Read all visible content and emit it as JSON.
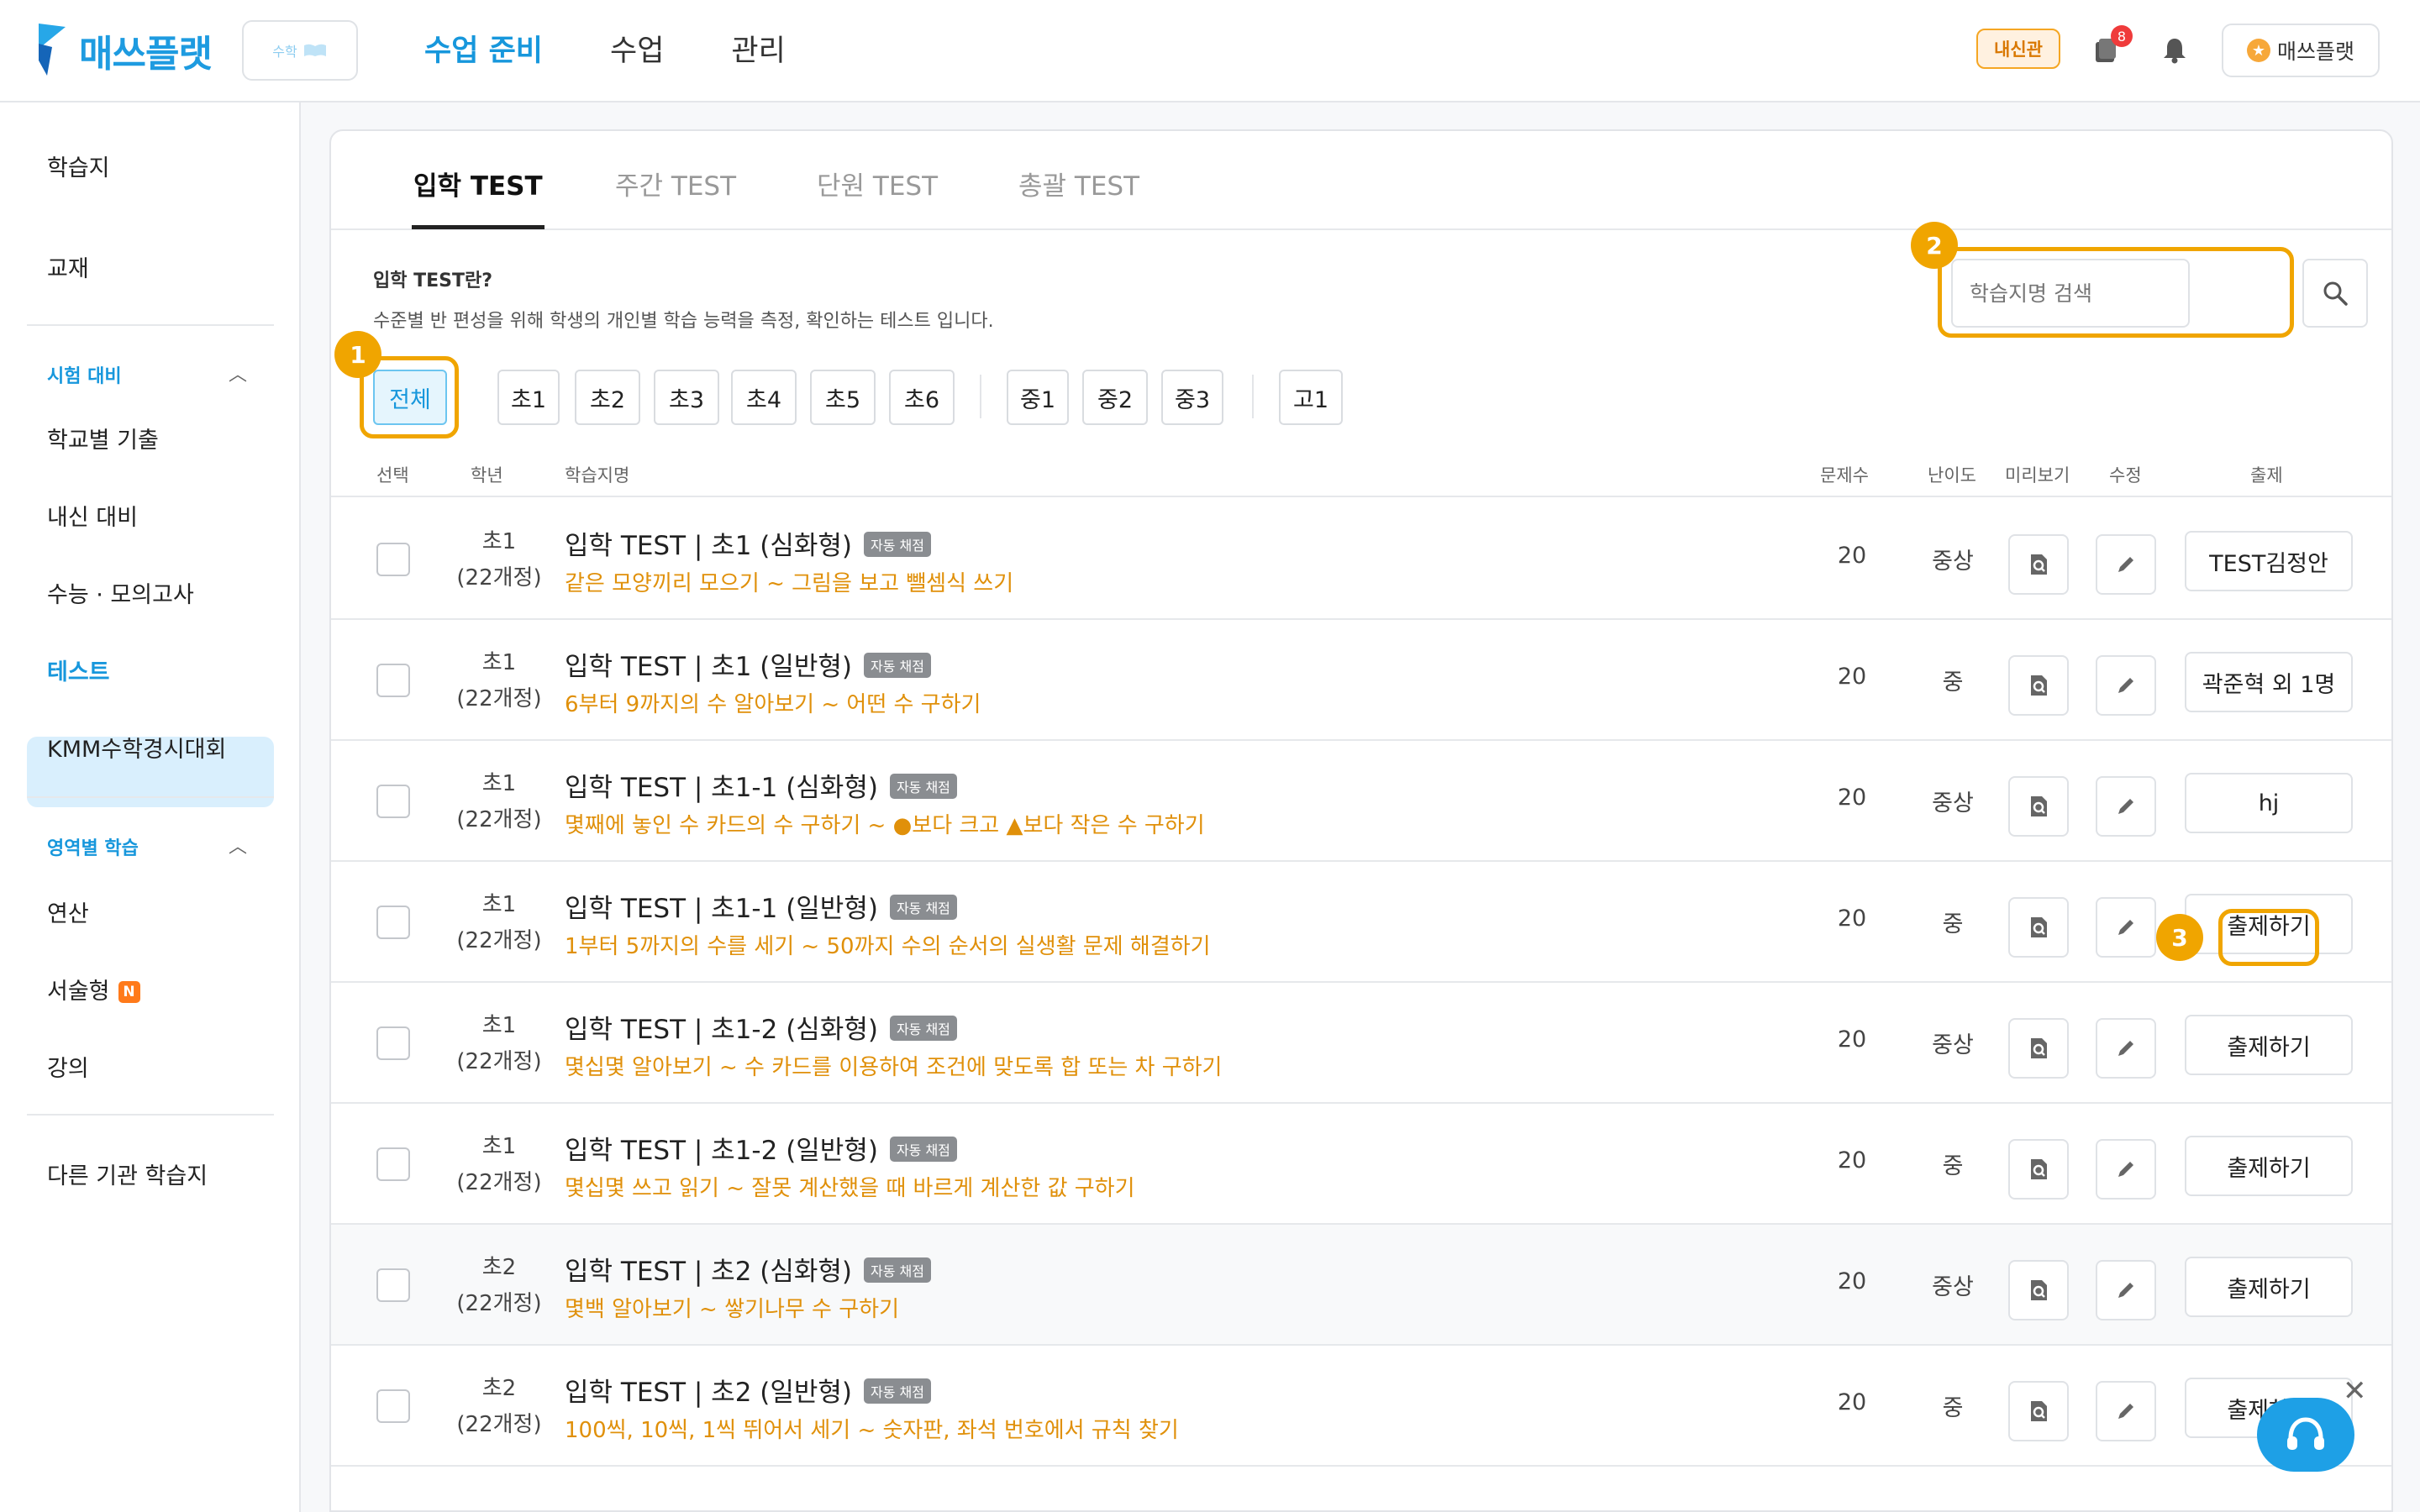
{
  "header": {
    "logo_text": "매쓰플랫",
    "subject_chip": "수학",
    "nav": [
      "수업 준비",
      "수업",
      "관리"
    ],
    "naesin_tag": "내신관",
    "notification_count": "8",
    "user_name": "매쓰플랫"
  },
  "sidebar": {
    "item_worksheets": "학습지",
    "item_textbook": "교재",
    "section_exam": "시험 대비",
    "item_school_past": "학교별 기출",
    "item_naesin": "내신 대비",
    "item_suneung": "수능 · 모의고사",
    "item_test": "테스트",
    "item_kmm": "KMM수학경시대회",
    "section_area": "영역별 학습",
    "item_calc": "연산",
    "item_essay": "서술형",
    "item_essay_badge": "N",
    "item_lecture": "강의",
    "item_other": "다른 기관 학습지"
  },
  "tabs": [
    "입학 TEST",
    "주간 TEST",
    "단원 TEST",
    "총괄 TEST"
  ],
  "description": {
    "title": "입학 TEST란?",
    "text": "수준별 반 편성을 위해 학생의 개인별 학습 능력을 측정, 확인하는 테스트 입니다."
  },
  "search": {
    "placeholder": "학습지명 검색"
  },
  "callouts": [
    "1",
    "2",
    "3"
  ],
  "grade_filters": {
    "all": "전체",
    "elementary": [
      "초1",
      "초2",
      "초3",
      "초4",
      "초5",
      "초6"
    ],
    "middle": [
      "중1",
      "중2",
      "중3"
    ],
    "high": [
      "고1"
    ]
  },
  "table": {
    "headers": {
      "select": "선택",
      "grade": "학년",
      "name": "학습지명",
      "count": "문제수",
      "difficulty": "난이도",
      "preview": "미리보기",
      "edit": "수정",
      "assign": "출제"
    },
    "auto_label": "자동 채점",
    "rows": [
      {
        "grade": "초1",
        "curriculum": "(22개정)",
        "title": "입학 TEST | 초1 (심화형)",
        "subtitle": "같은 모양끼리 모으기 ~ 그림을 보고 뺄셈식 쓰기",
        "count": "20",
        "difficulty": "중상",
        "action": "TEST김정안"
      },
      {
        "grade": "초1",
        "curriculum": "(22개정)",
        "title": "입학 TEST | 초1 (일반형)",
        "subtitle": "6부터 9까지의 수 알아보기 ~ 어떤 수 구하기",
        "count": "20",
        "difficulty": "중",
        "action": "곽준혁 외 1명"
      },
      {
        "grade": "초1",
        "curriculum": "(22개정)",
        "title": "입학 TEST | 초1-1 (심화형)",
        "subtitle": "몇째에 놓인 수 카드의 수 구하기 ~ ●보다 크고 ▲보다 작은 수 구하기",
        "count": "20",
        "difficulty": "중상",
        "action": "hj"
      },
      {
        "grade": "초1",
        "curriculum": "(22개정)",
        "title": "입학 TEST | 초1-1 (일반형)",
        "subtitle": "1부터 5까지의 수를 세기 ~ 50까지 수의 순서의 실생활 문제 해결하기",
        "count": "20",
        "difficulty": "중",
        "action": "출제하기"
      },
      {
        "grade": "초1",
        "curriculum": "(22개정)",
        "title": "입학 TEST | 초1-2 (심화형)",
        "subtitle": "몇십몇 알아보기 ~ 수 카드를 이용하여 조건에 맞도록 합 또는 차 구하기",
        "count": "20",
        "difficulty": "중상",
        "action": "출제하기"
      },
      {
        "grade": "초1",
        "curriculum": "(22개정)",
        "title": "입학 TEST | 초1-2 (일반형)",
        "subtitle": "몇십몇 쓰고 읽기 ~ 잘못 계산했을 때 바르게 계산한 값 구하기",
        "count": "20",
        "difficulty": "중",
        "action": "출제하기"
      },
      {
        "grade": "초2",
        "curriculum": "(22개정)",
        "title": "입학 TEST | 초2 (심화형)",
        "subtitle": "몇백 알아보기 ~ 쌓기나무 수 구하기",
        "count": "20",
        "difficulty": "중상",
        "action": "출제하기"
      },
      {
        "grade": "초2",
        "curriculum": "(22개정)",
        "title": "입학 TEST | 초2 (일반형)",
        "subtitle": "100씩, 10씩, 1씩 뛰어서 세기 ~ 숫자판, 좌석 번호에서 규칙 찾기",
        "count": "20",
        "difficulty": "중",
        "action": "출제하기"
      }
    ]
  },
  "colors": {
    "brand": "#1e9be0",
    "accent": "#1797dc",
    "highlight": "#f0a500",
    "subtitle": "#e0900a",
    "badge": "#ef3b3b"
  }
}
